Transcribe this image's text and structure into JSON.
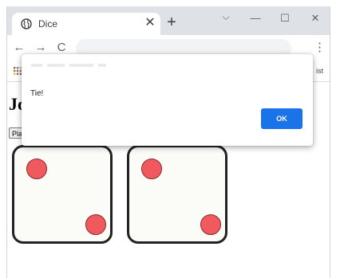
{
  "browser": {
    "tab_title": "Dice",
    "tab_close": "✕",
    "new_tab": "+",
    "tab_search": "⌵",
    "minimize": "—",
    "maximize": "☐",
    "close": "✕",
    "back": "←",
    "forward": "→",
    "reload": "C",
    "menu": "⋮",
    "bookmarks_right": "ist"
  },
  "page": {
    "heading": "Jo",
    "play_button": "Pla"
  },
  "dialog": {
    "message": "Tie!",
    "ok_label": "OK"
  },
  "dice": [
    {
      "value": 2
    },
    {
      "value": 2
    }
  ],
  "colors": {
    "pip": "#f05a5e",
    "ok_button": "#1a73e8",
    "tab_strip": "#dee1e6"
  },
  "icons": {
    "tab": "globe-icon",
    "apps": "apps-grid-icon"
  }
}
